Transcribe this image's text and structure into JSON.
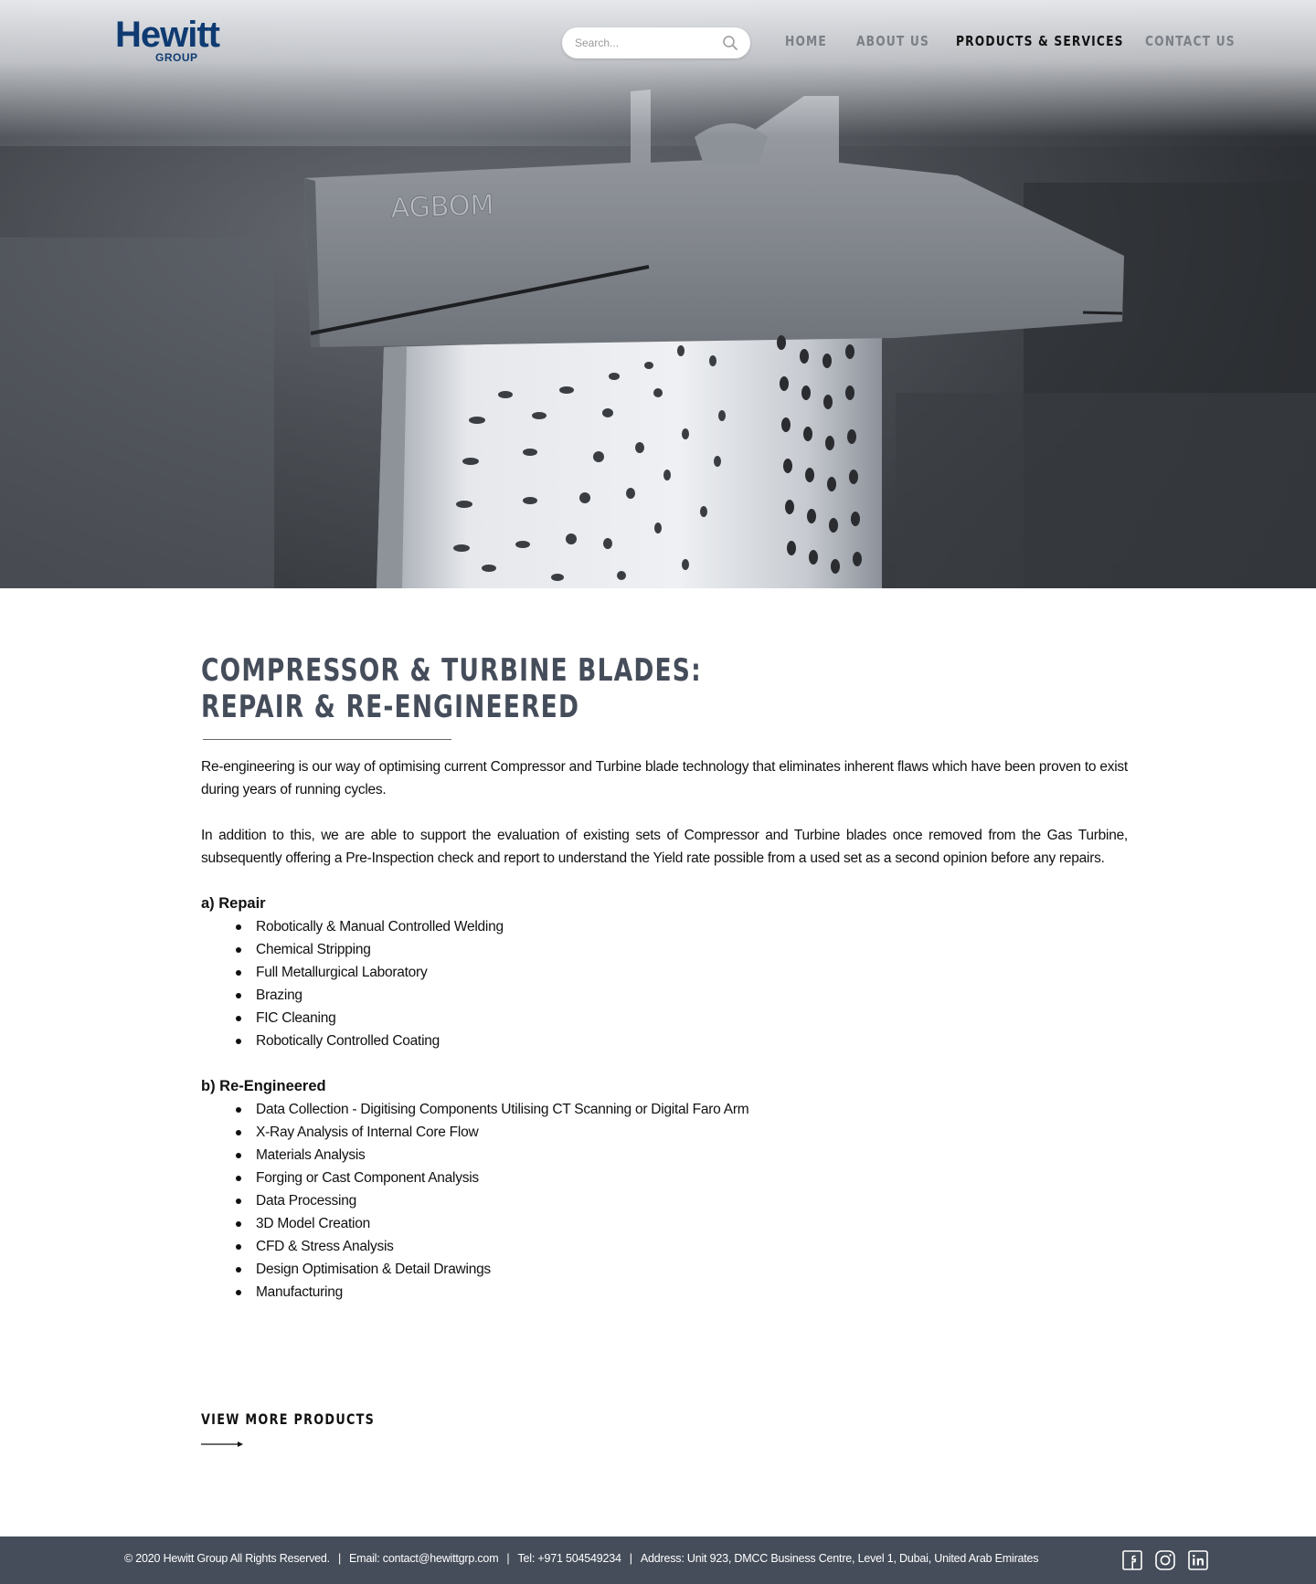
{
  "header": {
    "logo_word": "Hewitt",
    "logo_sub": "GROUP",
    "search_placeholder": "Search...",
    "nav": [
      {
        "label": "HOME",
        "active": false
      },
      {
        "label": "ABOUT US",
        "active": false
      },
      {
        "label": "PRODUCTS & SERVICES",
        "active": true
      },
      {
        "label": "CONTACT US",
        "active": false
      }
    ]
  },
  "hero": {
    "blade_marking": "AGBOM"
  },
  "main": {
    "title_line1": "COMPRESSOR & TURBINE BLADES:",
    "title_line2": "REPAIR & RE-ENGINEERED",
    "para1": "Re-engineering is our way of optimising current Compressor and Turbine blade technology that eliminates inherent flaws which have been proven to exist during years of running cycles.",
    "para2": "In addition to this, we are able to support the evaluation of existing sets of Compressor and Turbine blades once removed from the Gas Turbine, subsequently offering a Pre-Inspection check and report to understand the Yield rate possible from a used set as a second opinion before any repairs.",
    "repair": {
      "heading": "a) Repair",
      "items": [
        "Robotically & Manual Controlled Welding",
        "Chemical Stripping",
        "Full Metallurgical Laboratory",
        "Brazing",
        "FIC Cleaning",
        "Robotically Controlled Coating"
      ]
    },
    "reengineered": {
      "heading": "b) Re-Engineered",
      "items": [
        "Data Collection - Digitising Components Utilising CT Scanning or Digital Faro Arm",
        "X-Ray Analysis of Internal Core Flow",
        "Materials Analysis",
        "Forging or Cast Component Analysis",
        "Data Processing",
        "3D Model Creation",
        "CFD & Stress Analysis",
        "Design Optimisation & Detail Drawings",
        "Manufacturing"
      ]
    },
    "view_more": "VIEW MORE PRODUCTS"
  },
  "footer": {
    "copyright": "© 2020 Hewitt Group All Rights Reserved.",
    "email": "Email: contact@hewittgrp.com",
    "tel": "Tel: +971 504549234",
    "address": "Address: Unit 923, DMCC Business Centre, Level 1, Dubai, United Arab Emirates",
    "separator": "|",
    "social": [
      "facebook-icon",
      "instagram-icon",
      "linkedin-icon"
    ]
  },
  "colors": {
    "brand_navy": "#0f3b72",
    "title_slate": "#454d5b",
    "footer_bg": "#454d5a",
    "nav_inactive": "#7c8087",
    "nav_active": "#111111"
  }
}
